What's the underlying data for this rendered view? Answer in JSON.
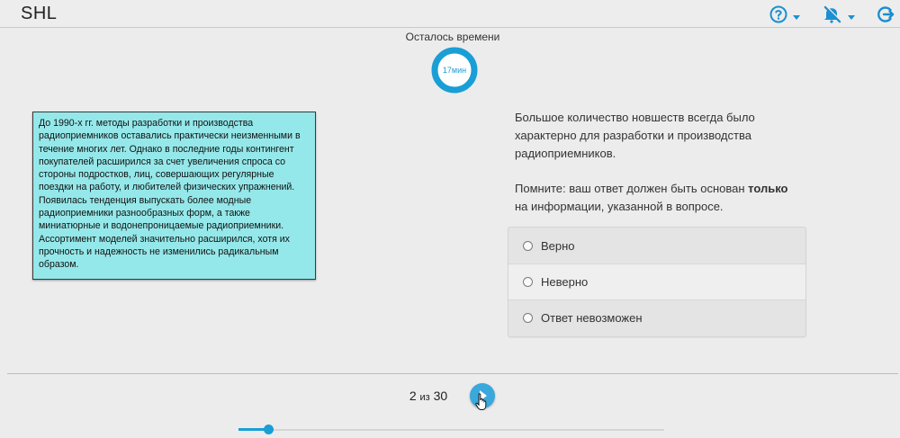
{
  "header": {
    "logo": "SHL",
    "icons": [
      "help-icon",
      "mute-icon",
      "exit-icon"
    ],
    "accent": "#1a8fd1"
  },
  "timer": {
    "label": "Осталось времени",
    "value": "17мин",
    "ring_color": "#1a9ed6"
  },
  "passage": {
    "text": "До 1990-х гг. методы разработки и производства радиоприемников оставались практически неизменными в течение многих лет. Однако в последние годы контингент покупателей расширился за счет увеличения спроса со стороны подростков, лиц, совершающих регулярные поездки на работу, и любителей физических упражнений. Появилась тенденция выпускать более модные радиоприемники разнообразных форм, а также миниатюрные и водонепроницаемые радиоприемники. Ассортимент моделей значительно расширился, хотя их прочность и надежность не изменились радикальным образом.",
    "background": "#95e8ea"
  },
  "question": {
    "statement": "Большое количество новшеств всегда было характерно для разработки и производства радиоприемников.",
    "reminder_prefix": "Помните: ваш ответ должен быть основан ",
    "reminder_bold": "только",
    "reminder_suffix": " на информации, указанной в вопросе."
  },
  "answers": [
    {
      "label": "Верно",
      "selected": false
    },
    {
      "label": "Неверно",
      "selected": false
    },
    {
      "label": "Ответ невозможен",
      "selected": false
    }
  ],
  "progress": {
    "current": "2",
    "separator": "из",
    "total": "30",
    "fraction": 0.07
  },
  "next_button": {
    "icon": "play-arrow-icon",
    "color": "#3aa8dc"
  }
}
